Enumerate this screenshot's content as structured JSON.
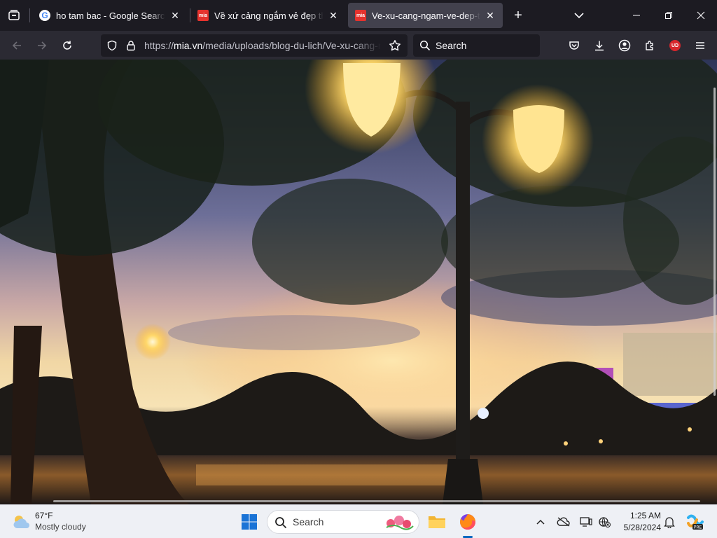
{
  "tabs": [
    {
      "title": "ho tam bac - Google Search",
      "favicon": "G",
      "active": false
    },
    {
      "title": "Về xứ cảng ngắm vẻ đẹp thơ mộng",
      "favicon": "mia",
      "active": false
    },
    {
      "title": "Ve-xu-cang-ngam-ve-dep-tho-mong",
      "favicon": "mia",
      "active": true
    }
  ],
  "toolbar": {
    "url_scheme": "https://",
    "url_host": "mia.vn",
    "url_path": "/media/uploads/blog-du-lich/Ve-xu-cang-ngam-ve-dep-tho-mong",
    "search_label": "Search",
    "account_badge": "UD"
  },
  "taskbar": {
    "weather_temp": "67°F",
    "weather_condition": "Mostly cloudy",
    "search_label": "Search",
    "time": "1:25 AM",
    "date": "5/28/2024"
  },
  "colors": {
    "tab_bg": "#1c1b22",
    "active_tab": "#42414d",
    "navbar": "#2b2a33",
    "taskbar": "#eef0f5"
  }
}
